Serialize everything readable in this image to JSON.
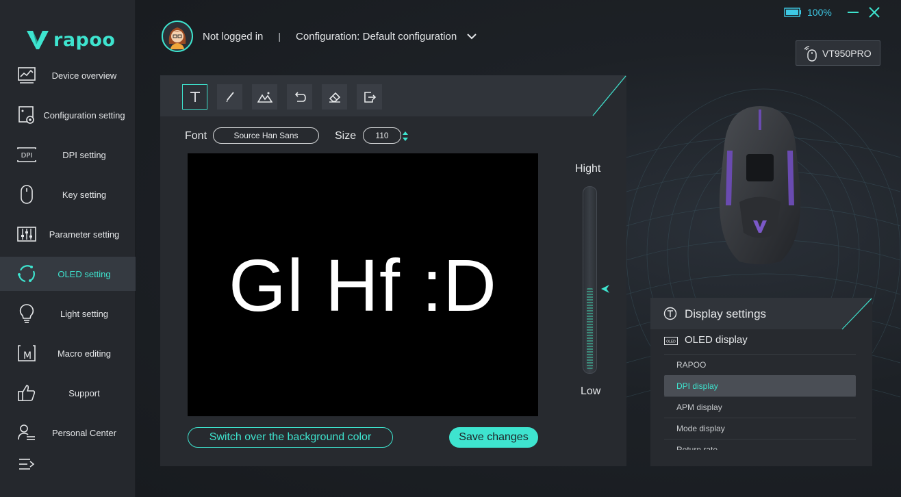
{
  "brand": {
    "logo_text": "rapoo",
    "accent": "#3ee4cf"
  },
  "sidebar": {
    "items": [
      {
        "label": "Device overview",
        "icon": "monitor-chart-icon"
      },
      {
        "label": "Configuration setting",
        "icon": "config-gear-icon"
      },
      {
        "label": "DPI setting",
        "icon": "dpi-icon"
      },
      {
        "label": "Key setting",
        "icon": "mouse-icon"
      },
      {
        "label": "Parameter setting",
        "icon": "sliders-icon"
      },
      {
        "label": "OLED setting",
        "icon": "oled-refresh-icon",
        "active": true
      },
      {
        "label": "Light setting",
        "icon": "bulb-icon"
      },
      {
        "label": "Macro editing",
        "icon": "macro-icon"
      },
      {
        "label": "Support",
        "icon": "thumbs-up-icon"
      },
      {
        "label": "Personal Center",
        "icon": "person-list-icon"
      }
    ]
  },
  "topbar": {
    "battery": "100%",
    "login_status": "Not logged in",
    "separator": "|",
    "configuration": "Configuration: Default configuration",
    "device": "VT950PRO"
  },
  "editor": {
    "tools": [
      "text-tool-icon",
      "brush-icon",
      "image-icon",
      "undo-icon",
      "eraser-icon",
      "export-icon"
    ],
    "font_label": "Font",
    "font_value": "Source Han Sans",
    "size_label": "Size",
    "size_value": "110",
    "canvas_text": "Gl Hf :D",
    "slider_top_label": "Hight",
    "slider_bottom_label": "Low",
    "brightness_level": 0.45,
    "switch_bg_label": "Switch over the background color",
    "save_label": "Save changes"
  },
  "display_settings": {
    "title": "Display settings",
    "subtitle": "OLED display",
    "items": [
      "RAPOO",
      "DPI display",
      "APM display",
      "Mode display",
      "Return rate"
    ],
    "selected_index": 1
  }
}
